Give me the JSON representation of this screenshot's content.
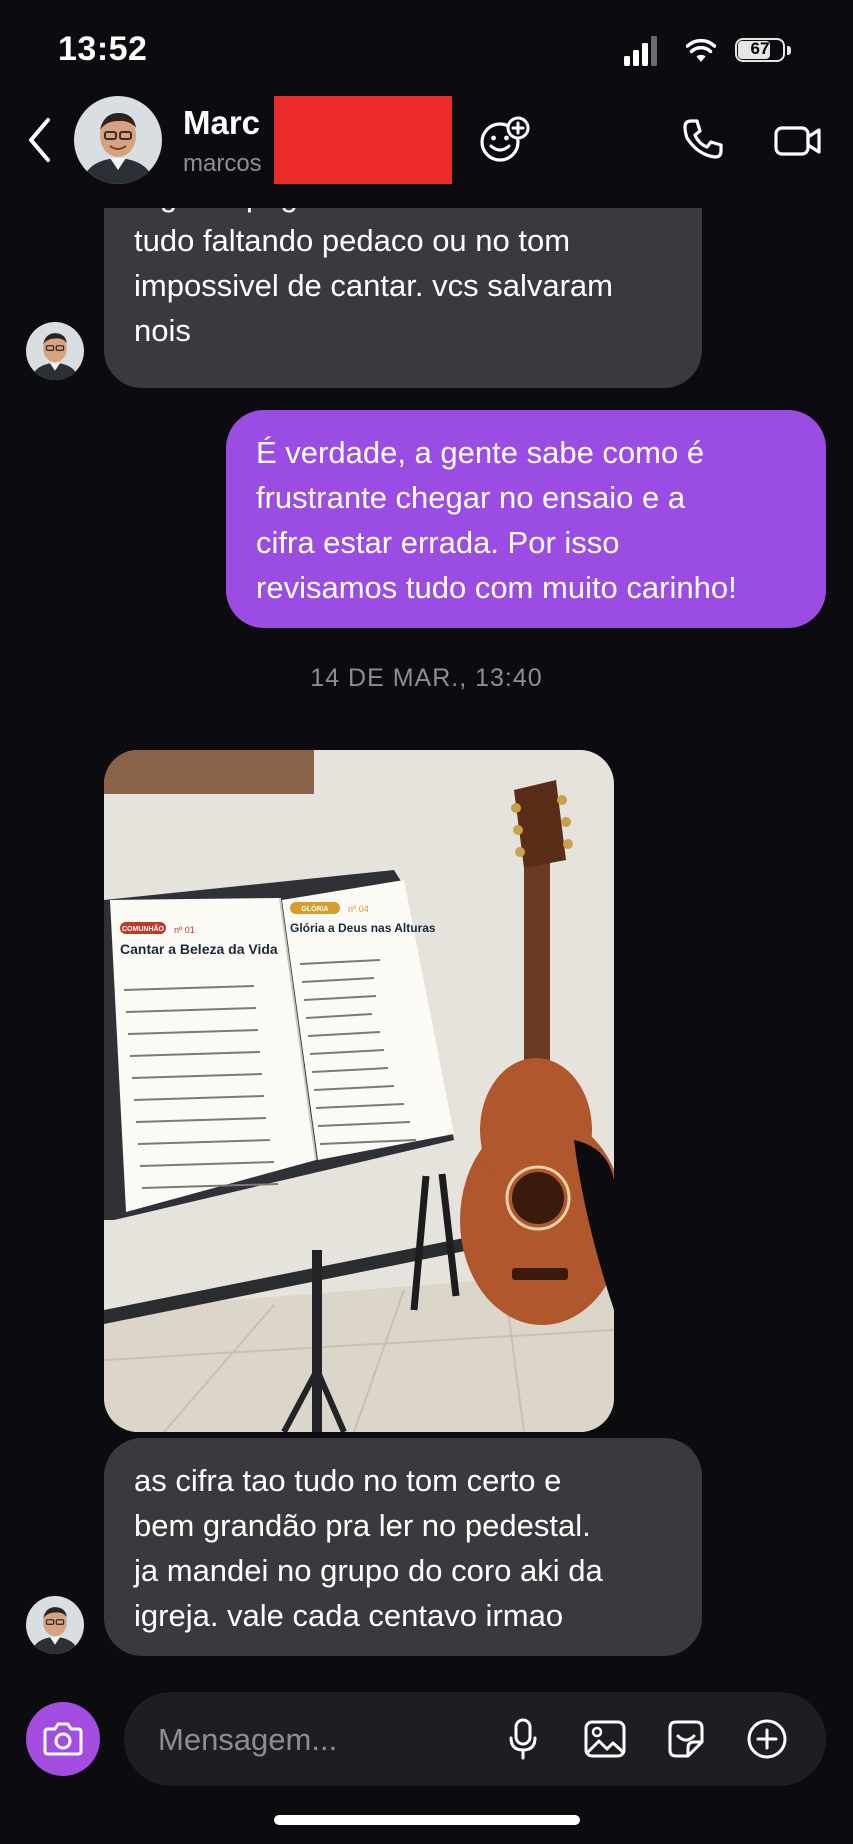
{
  "status_bar": {
    "time": "13:52",
    "battery": "67"
  },
  "header": {
    "name": "Marc",
    "username": "marcos",
    "icons": {
      "back": "chevron-left-icon",
      "sticker": "sticker-add-icon",
      "call": "phone-icon",
      "video": "video-camera-icon"
    }
  },
  "messages": [
    {
      "direction": "incoming",
      "lines": [
        "a gente pegava uns site ai e vinha",
        "tudo faltando pedaco ou no tom",
        "impossivel de cantar. vcs salvaram",
        "nois"
      ]
    },
    {
      "direction": "outgoing",
      "lines": [
        "É verdade, a gente sabe como é",
        "frustrante chegar no ensaio e a",
        "cifra estar errada. Por isso",
        "revisamos tudo com muito carinho!"
      ]
    },
    {
      "direction": "incoming",
      "lines": [
        "as cifra tao tudo no tom certo e",
        "bem grandão pra ler no pedestal.",
        "ja mandei no grupo do coro aki da",
        "igreja. vale cada centavo irmao"
      ]
    }
  ],
  "date_separator": "14 DE MAR., 13:40",
  "photo": {
    "left_sheet": {
      "badge": "COMUNHÃO",
      "number": "nº 01",
      "title": "Cantar a Beleza da Vida"
    },
    "right_sheet": {
      "badge": "GLÓRIA",
      "number": "nº 04",
      "title": "Glória a Deus nas Alturas"
    }
  },
  "composer": {
    "placeholder": "Mensagem..."
  },
  "colors": {
    "outgoing_bubble": "#9b4de3",
    "incoming_bubble": "#3a3a3e",
    "background": "#0c0c10"
  }
}
